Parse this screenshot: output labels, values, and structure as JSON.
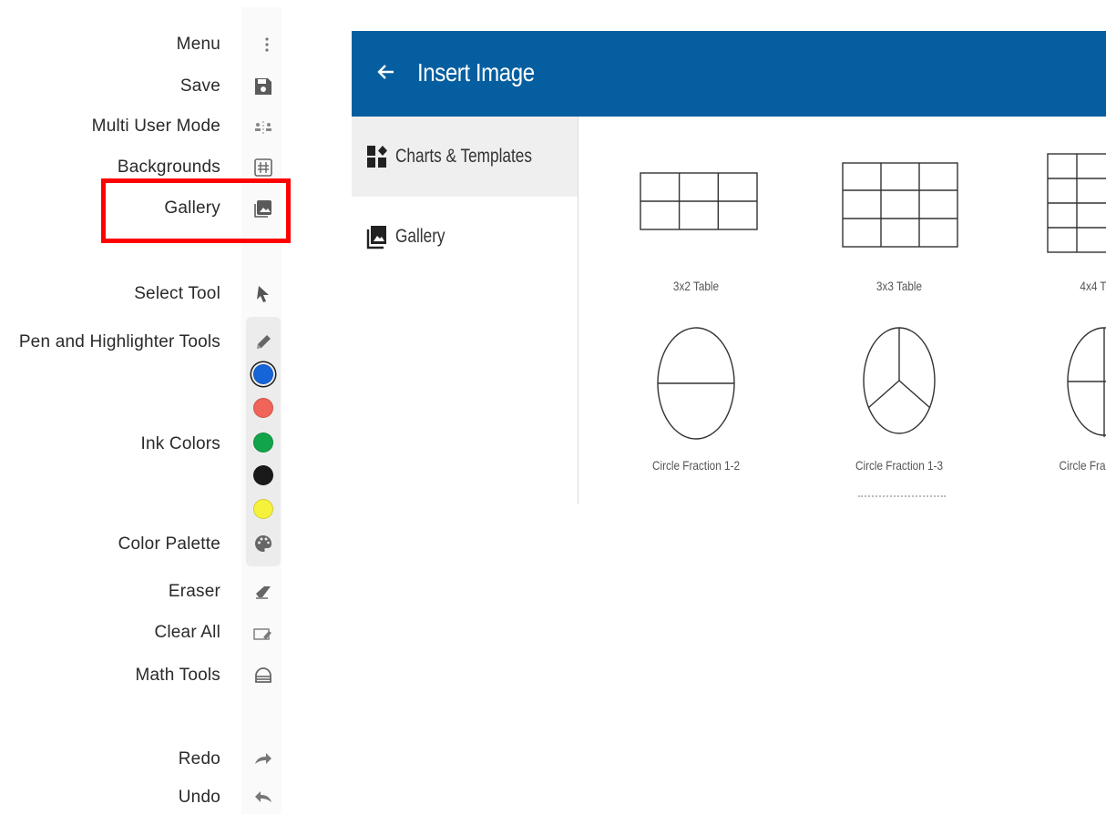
{
  "toolbar": {
    "labels": {
      "menu": "Menu",
      "save": "Save",
      "multi_user": "Multi User Mode",
      "backgrounds": "Backgrounds",
      "gallery": "Gallery",
      "select_tool": "Select Tool",
      "pen_highlighter": "Pen and Highlighter Tools",
      "ink_colors": "Ink Colors",
      "color_palette": "Color Palette",
      "eraser": "Eraser",
      "clear_all": "Clear All",
      "math_tools": "Math Tools",
      "redo": "Redo",
      "undo": "Undo"
    },
    "icons": [
      "more-vert-icon",
      "save-icon",
      "multi-user-icon",
      "grid-background-icon",
      "gallery-icon",
      "cursor-icon",
      "pencil-icon",
      "palette-icon",
      "eraser-icon",
      "clear-all-icon",
      "math-tools-icon",
      "redo-icon",
      "undo-icon"
    ],
    "ink_colors": [
      {
        "name": "blue",
        "hex": "#1565d8",
        "selected": true
      },
      {
        "name": "red",
        "hex": "#f0645a",
        "selected": false
      },
      {
        "name": "green",
        "hex": "#12a44a",
        "selected": false
      },
      {
        "name": "black",
        "hex": "#1a1a1a",
        "selected": false
      },
      {
        "name": "yellow",
        "hex": "#f6f23c",
        "selected": false
      }
    ],
    "highlight_color": "#ff0000"
  },
  "dialog": {
    "title": "Insert Image",
    "header_color": "#055ea0",
    "sidebar": [
      {
        "label": "Charts & Templates",
        "icon": "charts-templates-icon",
        "active": true
      },
      {
        "label": "Gallery",
        "icon": "gallery-icon",
        "active": false
      }
    ],
    "templates": [
      {
        "label": "3x2 Table",
        "kind": "table"
      },
      {
        "label": "3x3 Table",
        "kind": "table"
      },
      {
        "label": "4x4 T",
        "kind": "table"
      },
      {
        "label": "Circle Fraction 1-2",
        "kind": "circle"
      },
      {
        "label": "Circle Fraction 1-3",
        "kind": "circle"
      },
      {
        "label": "Circle Fra",
        "kind": "circle"
      }
    ]
  }
}
